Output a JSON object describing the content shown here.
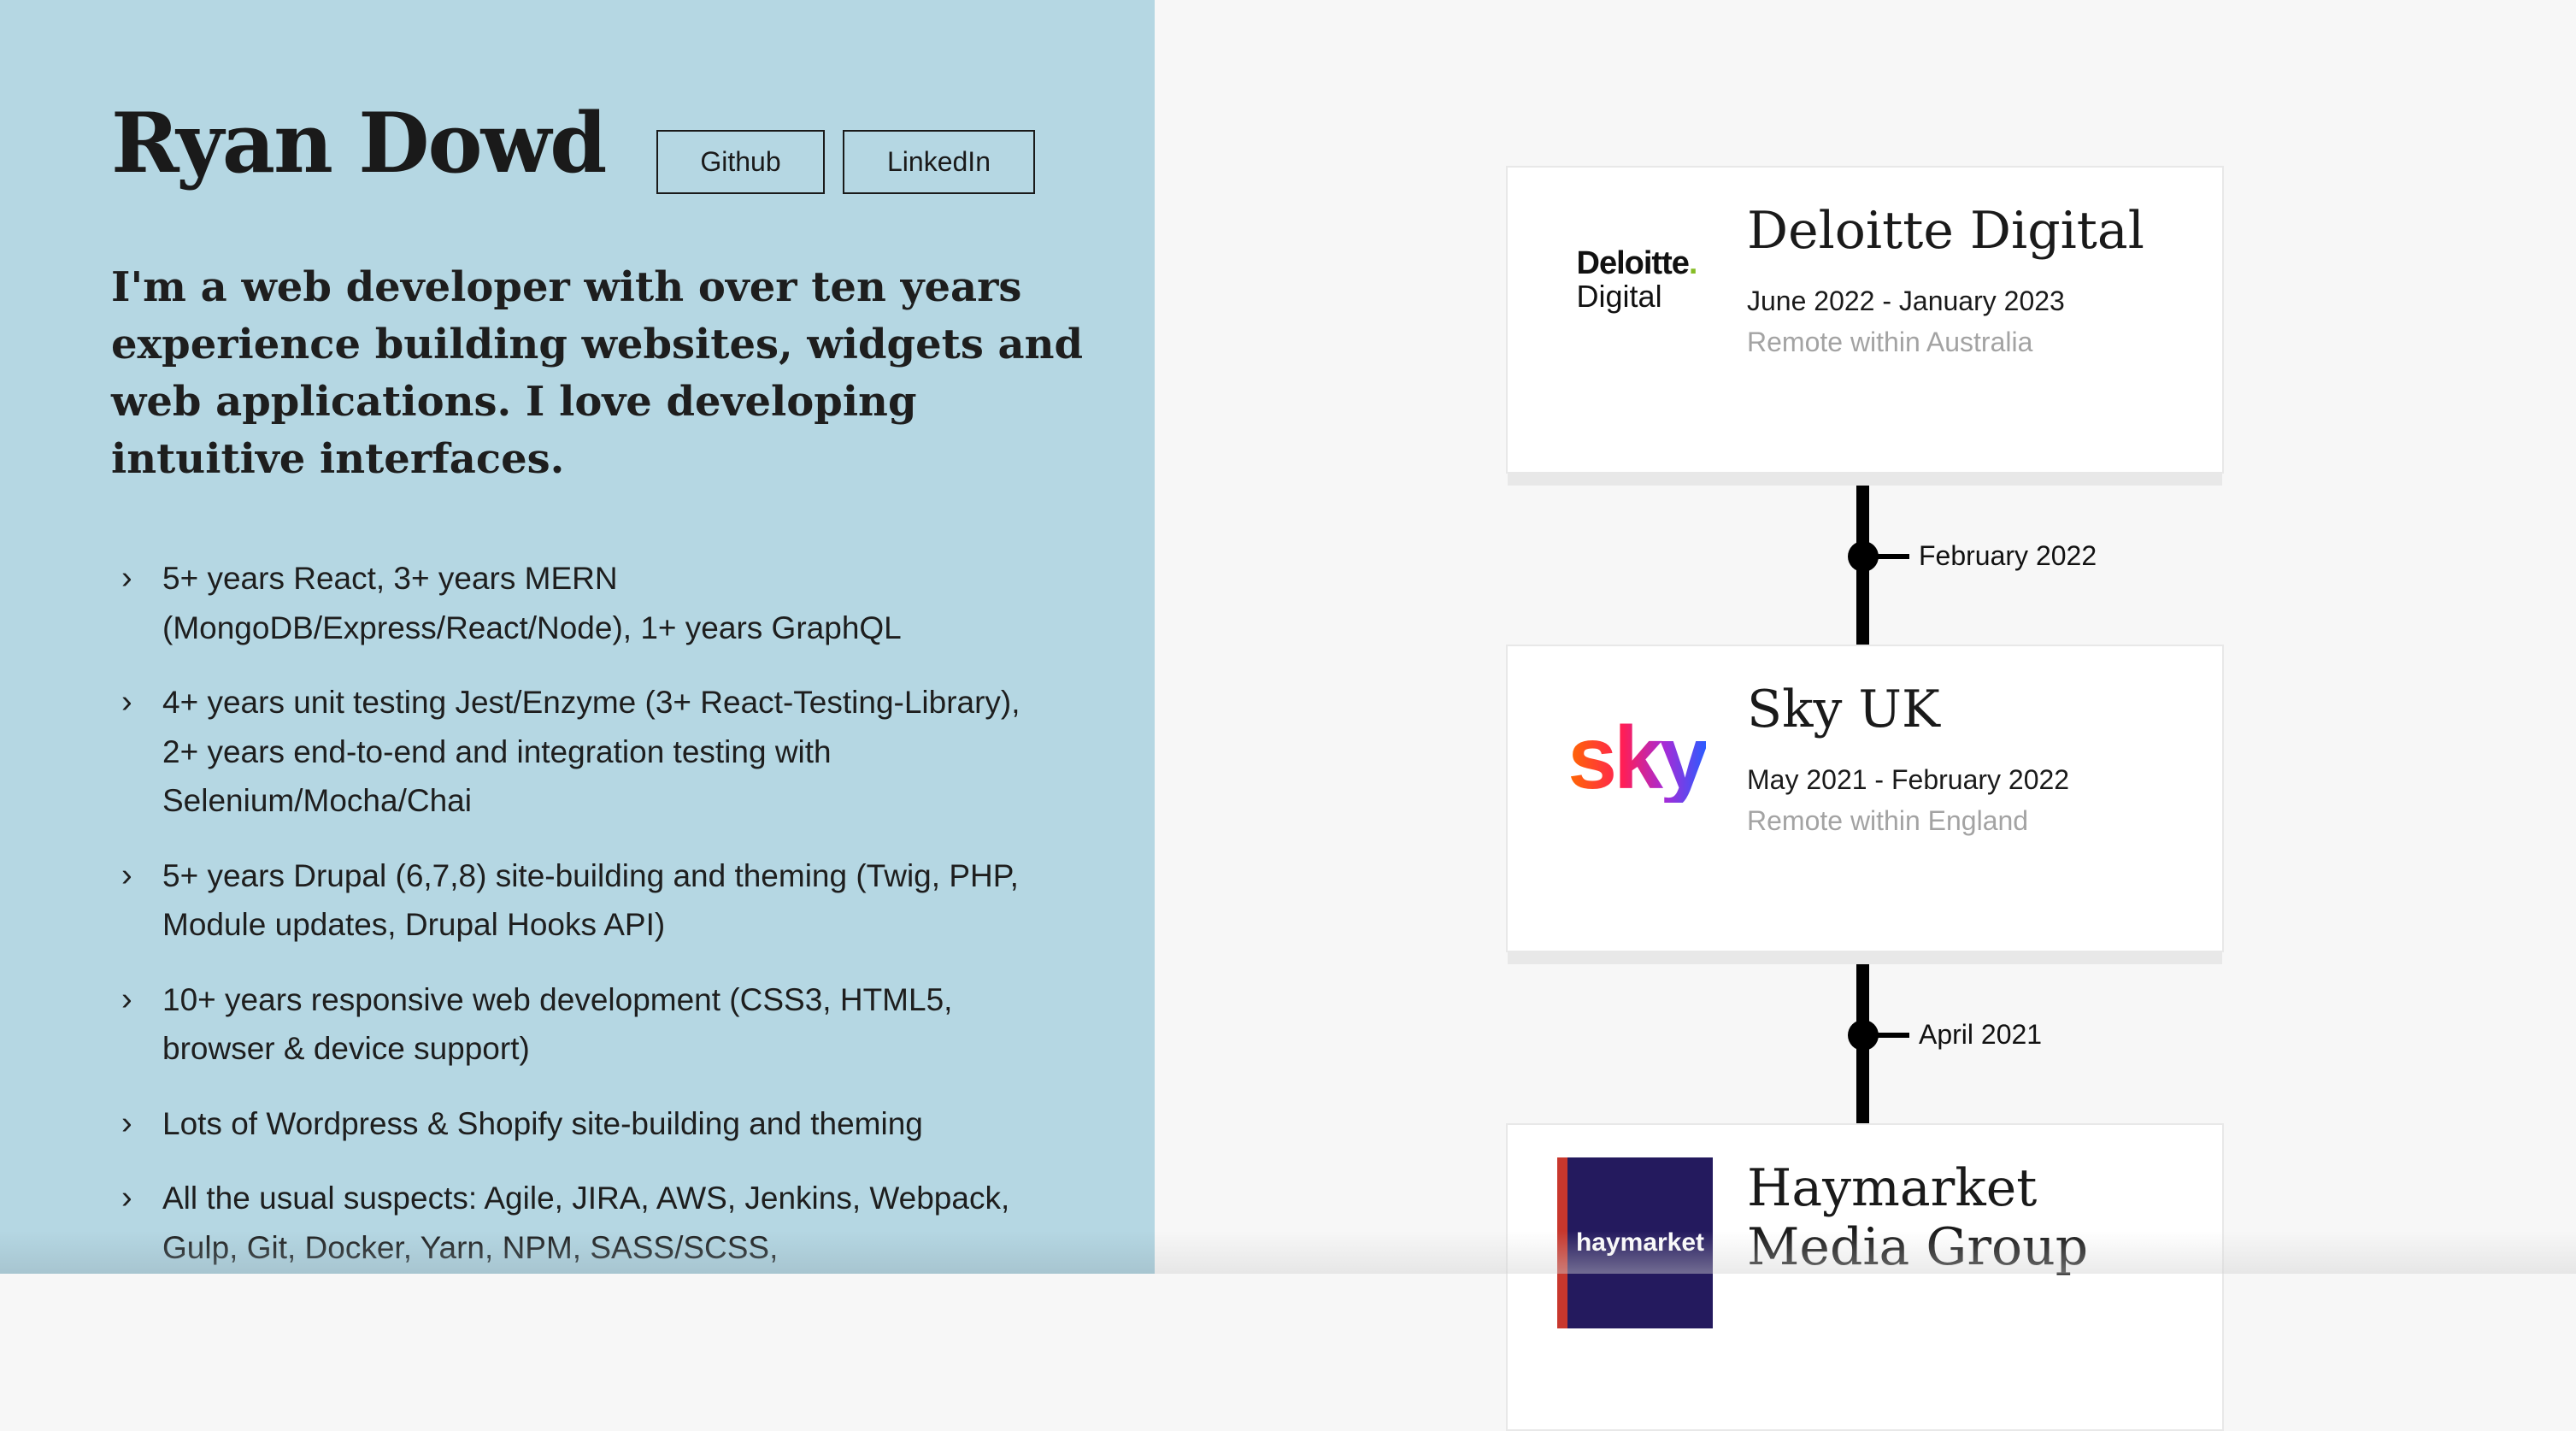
{
  "profile": {
    "name": "Ryan Dowd",
    "links": {
      "github": "Github",
      "linkedin": "LinkedIn"
    },
    "intro": "I'm a web developer with over ten years experience building websites, widgets and web applications. I love developing intuitive interfaces."
  },
  "skills": [
    "5+ years React, 3+ years MERN (MongoDB/Express/React/Node), 1+ years GraphQL",
    "4+ years unit testing Jest/Enzyme (3+ React-Testing-Library), 2+ years end-to-end and integration testing with Selenium/Mocha/Chai",
    "5+ years Drupal (6,7,8) site-building and theming (Twig, PHP, Module updates, Drupal Hooks API)",
    "10+ years responsive web development (CSS3, HTML5, browser & device support)",
    "Lots of Wordpress & Shopify site-building and theming",
    "All the usual suspects: Agile, JIRA, AWS, Jenkins, Webpack, Gulp, Git, Docker, Yarn, NPM, SASS/SCSS,"
  ],
  "timeline": {
    "jobs": [
      {
        "company": "Deloitte Digital",
        "period": "June 2022 - January 2023",
        "location": "Remote within Australia",
        "logo": {
          "line1": "Deloitte",
          "dot": ".",
          "line2": "Digital"
        }
      },
      {
        "company": "Sky UK",
        "period": "May 2021 - February 2022",
        "location": "Remote within England",
        "logo": {
          "text": "sky"
        }
      },
      {
        "company": "Haymarket Media Group",
        "logo": {
          "text": "haymarket"
        }
      }
    ],
    "markers": [
      "February 2022",
      "April 2021"
    ]
  },
  "colors": {
    "left_panel": "#b5d7e3",
    "right_panel": "#f7f7f7",
    "deloitte_green": "#86bc25",
    "haymarket_navy": "#241a5e",
    "haymarket_red": "#c8372d"
  }
}
